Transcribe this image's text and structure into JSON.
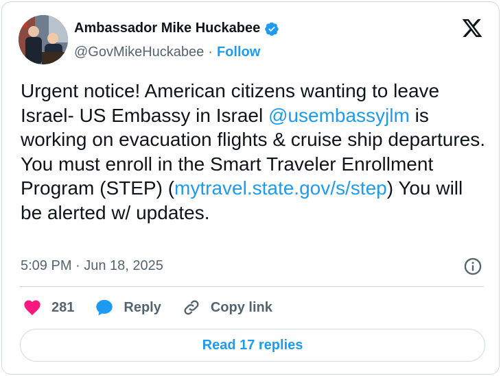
{
  "author": {
    "display_name": "Ambassador Mike Huckabee",
    "handle": "@GovMikeHuckabee",
    "separator": "·",
    "follow_label": "Follow"
  },
  "tweet": {
    "text_1": "Urgent notice! American citizens wanting to leave Israel-  US Embassy in Israel ",
    "mention": "@usembassyjlm",
    "text_2": " is working on evacuation flights & cruise ship departures.\nYou must enroll in the Smart Traveler Enrollment Program (STEP) (",
    "url": "mytravel.state.gov/s/step",
    "text_3": ") You will be alerted w/ updates.",
    "timestamp": "5:09 PM · Jun 18, 2025"
  },
  "actions": {
    "likes": "281",
    "reply_label": "Reply",
    "copy_link_label": "Copy link"
  },
  "read_replies_label": "Read 17 replies",
  "colors": {
    "accent": "#1d9bf0",
    "like": "#f91880",
    "text": "#0f1419",
    "secondary": "#536471",
    "border": "#cfd9de"
  },
  "icons": [
    "verified-badge-icon",
    "x-logo-icon",
    "info-icon",
    "heart-icon",
    "reply-bubble-icon",
    "link-icon"
  ]
}
